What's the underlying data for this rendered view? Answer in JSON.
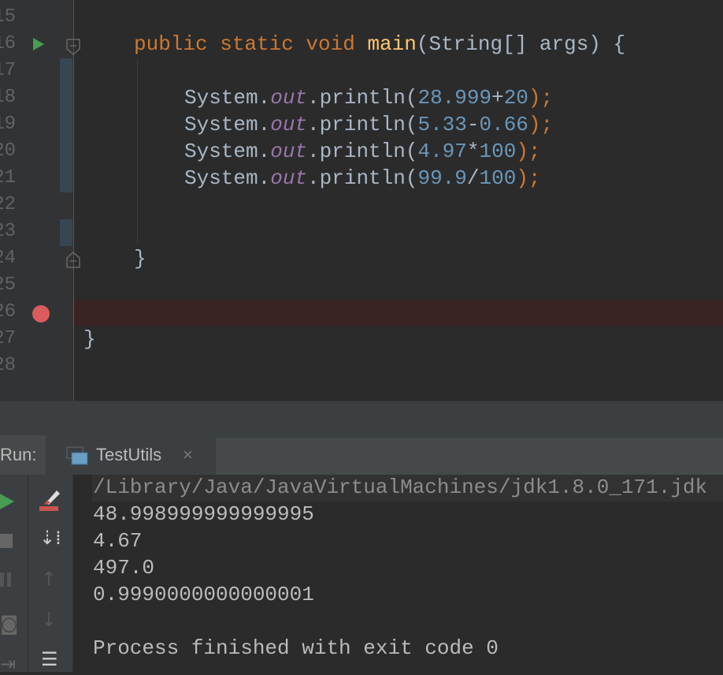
{
  "editor": {
    "line_numbers": [
      "15",
      "16",
      "17",
      "18",
      "19",
      "20",
      "21",
      "22",
      "23",
      "24",
      "25",
      "26",
      "27",
      "28"
    ],
    "lines": {
      "main_sig": {
        "kw": "public static void ",
        "fn": "main",
        "rest": "(String[] args) {"
      },
      "p1": {
        "a": "System.",
        "b": "out",
        "c": ".println(",
        "n1": "28.999",
        "op": "+",
        "n2": "20",
        "end": ");"
      },
      "p2": {
        "a": "System.",
        "b": "out",
        "c": ".println(",
        "n1": "5.33",
        "op": "-",
        "n2": "0.66",
        "end": ");"
      },
      "p3": {
        "a": "System.",
        "b": "out",
        "c": ".println(",
        "n1": "4.97",
        "op": "*",
        "n2": "100",
        "end": ");"
      },
      "p4": {
        "a": "System.",
        "b": "out",
        "c": ".println(",
        "n1": "99.9",
        "op": "/",
        "n2": "100",
        "end": ");"
      },
      "close_method": "}",
      "close_class": "}"
    }
  },
  "run": {
    "label": "Run:",
    "tab": "TestUtils",
    "close": "×",
    "output": [
      "/Library/Java/JavaVirtualMachines/jdk1.8.0_171.jdk",
      "48.998999999999995",
      "4.67",
      "497.0",
      "0.9990000000000001",
      "",
      "Process finished with exit code 0"
    ]
  },
  "colors": {
    "keyword": "#cc7832",
    "number": "#6897bb",
    "field": "#9876aa",
    "method": "#ffc66d"
  }
}
